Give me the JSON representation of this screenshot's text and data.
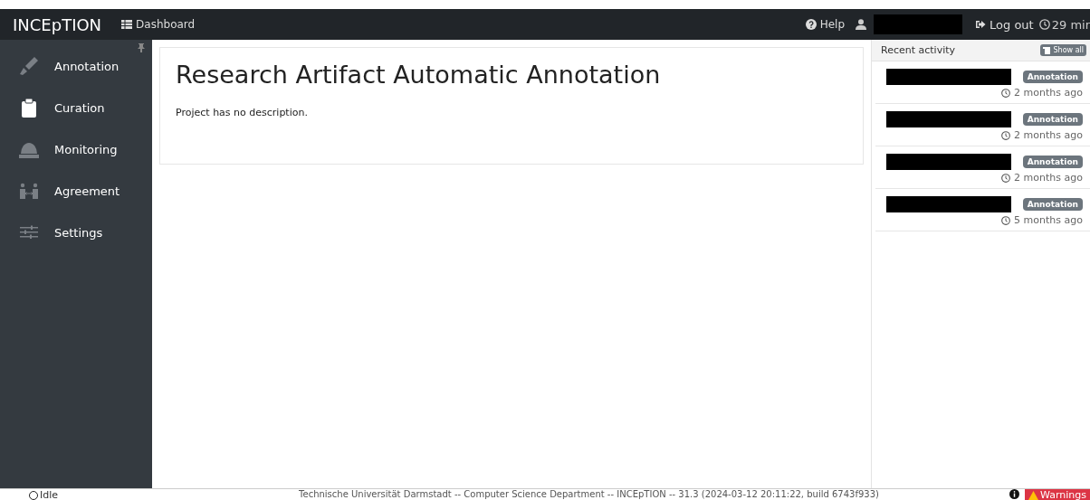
{
  "navbar": {
    "brand": "INCEpTION",
    "dashboard": "Dashboard",
    "help": "Help",
    "logout": "Log out",
    "timer": "29 mir"
  },
  "sidebar": {
    "items": [
      {
        "label": "Annotation",
        "kind": "marker"
      },
      {
        "label": "Curation",
        "kind": "clipboard"
      },
      {
        "label": "Monitoring",
        "kind": "helmet"
      },
      {
        "label": "Agreement",
        "kind": "agreement"
      },
      {
        "label": "Settings",
        "kind": "sliders"
      }
    ]
  },
  "project": {
    "title": "Research Artifact Automatic Annotation",
    "description": "Project has no description."
  },
  "activity": {
    "title": "Recent activity",
    "show_all": "Show all",
    "items": [
      {
        "badge": "Annotation",
        "time": "2 months ago"
      },
      {
        "badge": "Annotation",
        "time": "2 months ago"
      },
      {
        "badge": "Annotation",
        "time": "2 months ago"
      },
      {
        "badge": "Annotation",
        "time": "5 months ago"
      }
    ]
  },
  "footer": {
    "status": "Idle",
    "text": "Technische Universität Darmstadt -- Computer Science Department -- INCEpTION -- 31.3 (2024-03-12 20:11:22, build 6743f933)",
    "warnings": "Warnings"
  }
}
